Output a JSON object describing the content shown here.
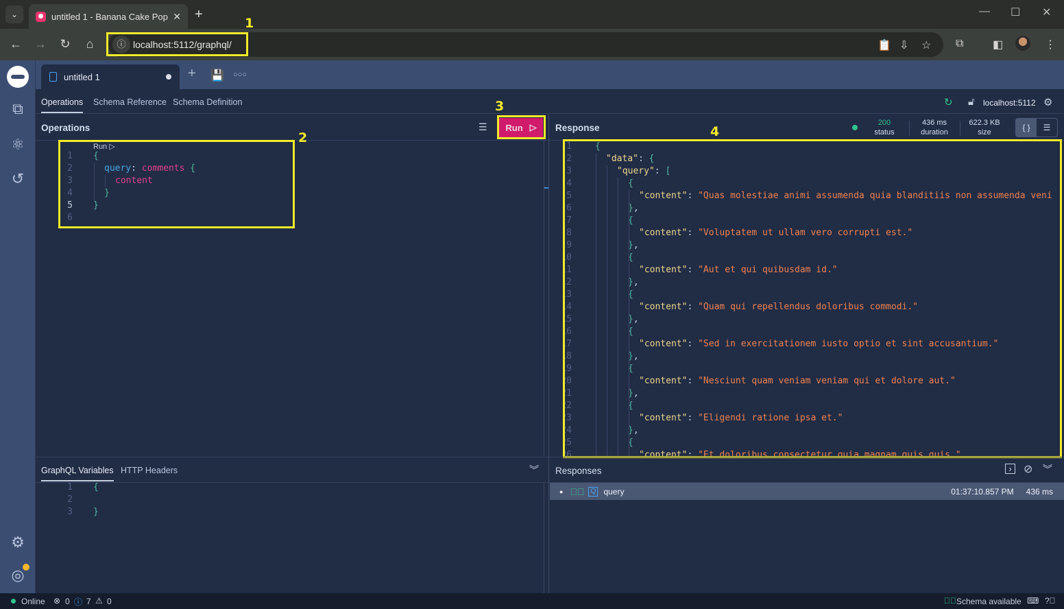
{
  "browser": {
    "tab_title": "untitled 1 - Banana Cake Pop",
    "url": "localhost:5112/graphql/"
  },
  "annotations": [
    "1",
    "2",
    "3",
    "4"
  ],
  "app": {
    "doc_tab": "untitled 1",
    "sub_tabs": [
      "Operations",
      "Schema Reference",
      "Schema Definition"
    ],
    "server": "localhost:5112",
    "operations": {
      "title": "Operations",
      "run_label": "Run",
      "codelens": "Run ▷",
      "lines": [
        {
          "n": "1",
          "text": "{"
        },
        {
          "n": "2",
          "field": "query",
          "name": "comments",
          "brace": "{"
        },
        {
          "n": "3",
          "name": "content"
        },
        {
          "n": "4",
          "text": "}"
        },
        {
          "n": "5",
          "text": "}"
        },
        {
          "n": "6",
          "text": ""
        }
      ]
    },
    "response": {
      "title": "Response",
      "status": "200",
      "status_label": "status",
      "duration": "436 ms",
      "duration_label": "duration",
      "size": "622.3 KB",
      "size_label": "size",
      "contents": [
        "Quas molestiae animi assumenda quia blanditiis non assumenda veni",
        "Voluptatem ut ullam vero corrupti est.",
        "Aut et qui quibusdam id.",
        "Quam qui repellendus doloribus commodi.",
        "Sed in exercitationem iusto optio et sint accusantium.",
        "Nesciunt quam veniam veniam qui et dolore aut.",
        "Eligendi ratione ipsa et.",
        "Et doloribus consectetur quia magnam quis quis."
      ]
    },
    "variables": {
      "tabs": [
        "GraphQL Variables",
        "HTTP Headers"
      ],
      "lines": [
        "{",
        "",
        "}"
      ]
    },
    "responses": {
      "title": "Responses",
      "items": [
        {
          "name": "query",
          "time": "01:37:10.857 PM",
          "duration": "436 ms"
        }
      ]
    },
    "status_bar": {
      "online": "Online",
      "errors": "0",
      "infos": "7",
      "warnings": "0",
      "schema": "Schema available"
    }
  }
}
